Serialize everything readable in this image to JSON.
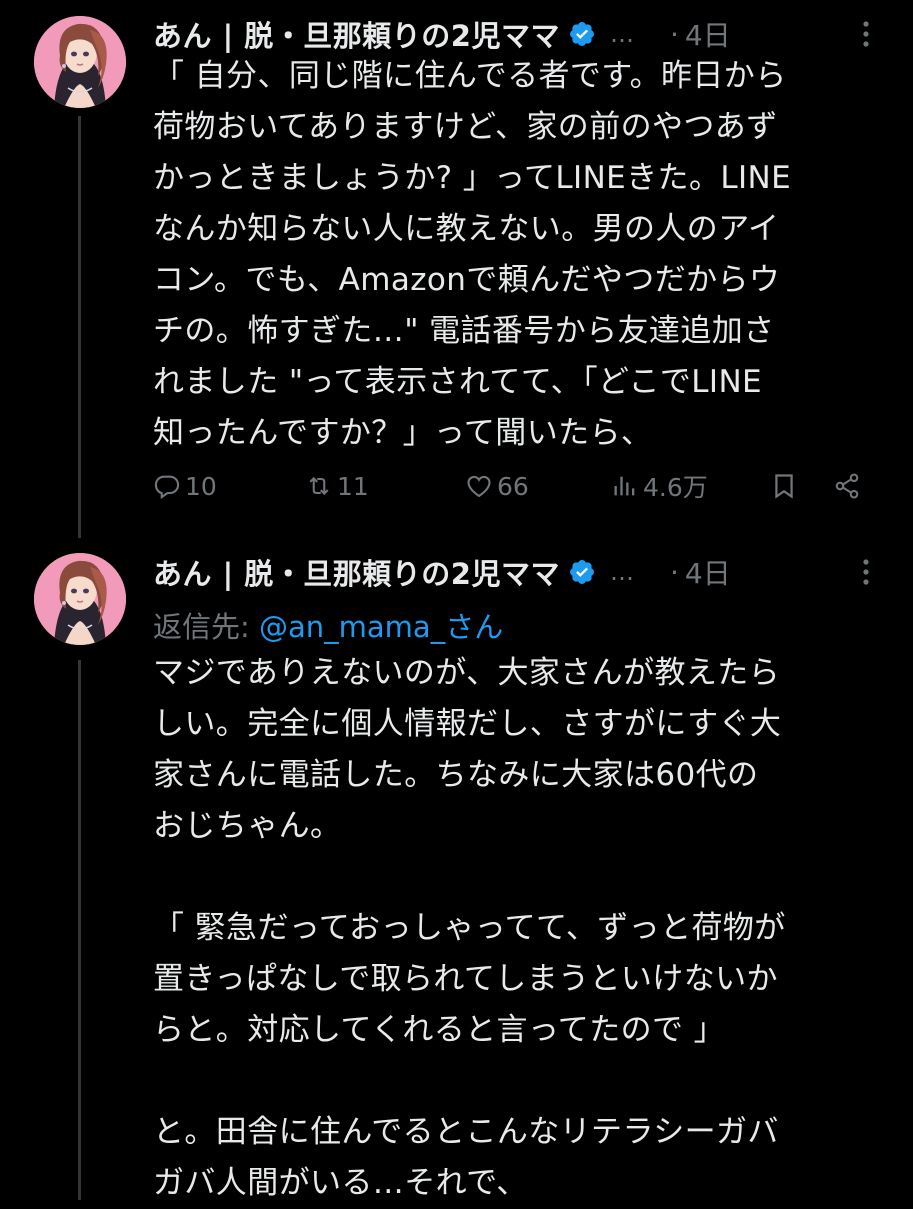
{
  "colors": {
    "background": "#000000",
    "text": "#e7e9ea",
    "muted": "#71767b",
    "accent": "#1d9bf0",
    "thread_line": "#333639"
  },
  "tweets": [
    {
      "display_name": "あん | 脱・旦那頼りの2児ママ",
      "verified_icon": "verified-badge-icon",
      "handle_truncated": "…",
      "time_separator": "·",
      "time": "4日",
      "body_lines": [
        "「 自分、同じ階に住んでる者です。昨日から",
        "荷物おいてありますけど、家の前のやつあず",
        "かっときましょうか? 」ってLINEきた。LINE",
        "なんか知らない人に教えない。男の人のアイ",
        "コン。でも、Amazonで頼んだやつだからウ",
        "チの。怖すぎた…\" 電話番号から友達追加さ",
        "れました \"って表示されてて、「どこでLINE",
        "知ったんですか？」って聞いたら、"
      ],
      "actions": {
        "reply_count": "10",
        "retweet_count": "11",
        "like_count": "66",
        "view_count": "4.6万"
      }
    },
    {
      "display_name": "あん | 脱・旦那頼りの2児ママ",
      "verified_icon": "verified-badge-icon",
      "handle_truncated": "…",
      "time_separator": "·",
      "time": "4日",
      "reply_to_label": "返信先: ",
      "reply_to_mention": "@an_mama_さん",
      "body_lines": [
        "マジでありえないのが、大家さんが教えたら",
        "しい。完全に個人情報だし、さすがにすぐ大",
        "家さんに電話した。ちなみに大家は60代の",
        "おじちゃん。",
        "",
        "「 緊急だっておっしゃってて、ずっと荷物が",
        "置きっぱなしで取られてしまうといけないか",
        "らと。対応してくれると言ってたので 」",
        "",
        "と。田舎に住んでるとこんなリテラシーガバ",
        "ガバ人間がいる…それで、"
      ]
    }
  ]
}
